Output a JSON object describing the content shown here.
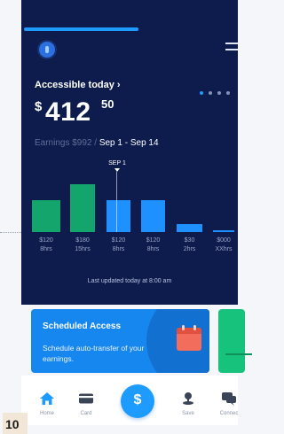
{
  "header": {
    "accessible_label": "Accessible today ›",
    "amount_currency": "$",
    "amount_whole": "412",
    "amount_cents": "50",
    "earnings_text": "Earnings $992 / ",
    "period_text": "Sep 1 - Sep 14"
  },
  "chart_data": {
    "type": "bar",
    "marker_label": "SEP 1",
    "categories": [
      "$120 8hrs",
      "$180 15hrs",
      "$120 8hrs",
      "$120 8hrs",
      "$30 2hrs",
      "$000 XXhrs"
    ],
    "amount_labels": [
      "$120",
      "$180",
      "$120",
      "$120",
      "$30",
      "$000"
    ],
    "hour_labels": [
      "8hrs",
      "15hrs",
      "8hrs",
      "8hrs",
      "2hrs",
      "XXhrs"
    ],
    "values": [
      120,
      180,
      120,
      120,
      30,
      0
    ],
    "bar_colors": [
      "#14a56c",
      "#14a56c",
      "#1e90ff",
      "#1e90ff",
      "#1e90ff",
      "#1e90ff"
    ],
    "ylim": [
      0,
      180
    ]
  },
  "footer": {
    "updated_text": "Last updated today at 8:00 am"
  },
  "card": {
    "title": "Scheduled Access",
    "description": "Schedule auto-transfer of your earnings."
  },
  "nav": {
    "home": "Home",
    "card": "Card",
    "pay_symbol": "$",
    "save": "Save",
    "connect": "Connec"
  },
  "badge_number": "10",
  "colors": {
    "background_dark": "#0e1c4d",
    "accent_blue": "#1e9bff",
    "accent_green": "#14a56c"
  }
}
